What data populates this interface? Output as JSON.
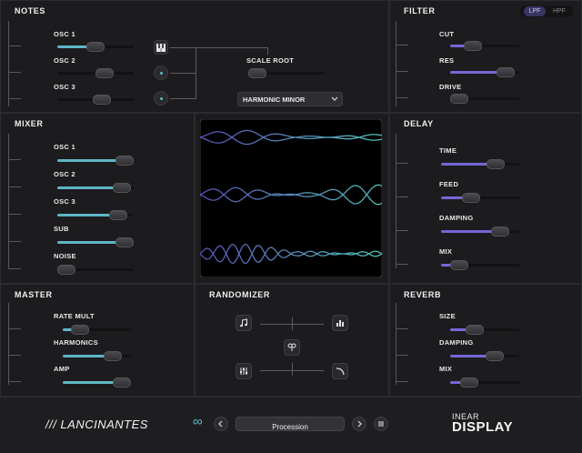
{
  "notes": {
    "title": "NOTES",
    "osc1": "OSC 1",
    "osc2": "OSC 2",
    "osc3": "OSC 3",
    "scale_root": "SCALE ROOT",
    "scale_select": "HARMONIC MINOR",
    "osc1_value": 0.5,
    "osc2_value": 0.62,
    "osc3_value": 0.58,
    "scale_root_value": 0.08
  },
  "filter": {
    "title": "FILTER",
    "lpf": "LPF",
    "hpf": "HPF",
    "cut": "CUT",
    "res": "RES",
    "drive": "DRIVE",
    "cut_value": 0.33,
    "res_value": 0.8,
    "drive_value": 0.1
  },
  "mixer": {
    "title": "MIXER",
    "osc1": "OSC 1",
    "osc2": "OSC 2",
    "osc3": "OSC 3",
    "sub": "SUB",
    "noise": "NOISE",
    "osc1_value": 0.88,
    "osc2_value": 0.85,
    "osc3_value": 0.8,
    "sub_value": 0.88,
    "noise_value": 0.05
  },
  "delay": {
    "title": "DELAY",
    "time": "TIME",
    "feed": "FEED",
    "damping": "DAMPING",
    "mix": "MIX",
    "time_value": 0.7,
    "feed_value": 0.38,
    "damping_value": 0.75,
    "mix_value": 0.23
  },
  "master": {
    "title": "MASTER",
    "rate_mult": "RATE MULT",
    "harmonics": "HARMONICS",
    "amp": "AMP",
    "rate_mult_value": 0.25,
    "harmonics_value": 0.72,
    "amp_value": 0.85
  },
  "randomizer": {
    "title": "RANDOMIZER"
  },
  "reverb": {
    "title": "REVERB",
    "size": "SIZE",
    "damping": "DAMPING",
    "mix": "MIX",
    "size_value": 0.35,
    "damping_value": 0.65,
    "mix_value": 0.28
  },
  "footer": {
    "logo": "/// LANCINANTES",
    "preset": "Procession",
    "brand_top": "INEAR",
    "brand_bottom": "DISPLAY"
  },
  "colors": {
    "teal": "#5fb6c6",
    "violet": "#7468d6",
    "bg": "#1c1c1f"
  }
}
